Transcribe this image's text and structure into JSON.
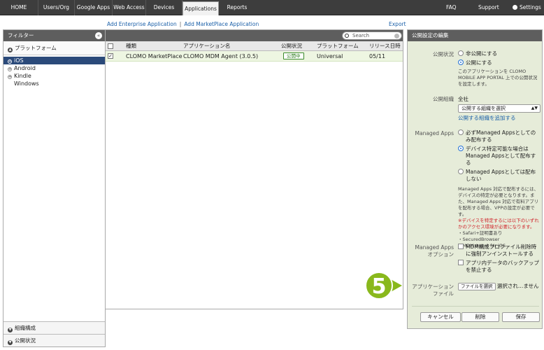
{
  "nav": {
    "tabs": [
      "HOME",
      "Users/Org",
      "Google Apps",
      "Web Access",
      "Devices",
      "Applications",
      "Reports"
    ],
    "active": "Applications",
    "right": {
      "faq": "FAQ",
      "support": "Support",
      "settings": "Settings"
    }
  },
  "sublinks": {
    "add_enterprise": "Add Enterprise Application",
    "sep": "|",
    "add_marketplace": "Add MarketPlace Application",
    "export": "Export"
  },
  "filter": {
    "title": "フィルター",
    "close": "«",
    "section_platform": "プラットフォーム",
    "platforms": [
      "iOS",
      "Android",
      "Kindle",
      "Windows"
    ],
    "selected": "iOS",
    "bottom_org": "組織構成",
    "bottom_status": "公開状況"
  },
  "table": {
    "search_placeholder": "Search",
    "headers": [
      "種類",
      "アプリケーション名",
      "公開状況",
      "プラットフォーム",
      "リリース日時"
    ],
    "rows": [
      {
        "type": "CLOMO MarketPlace",
        "name": "CLOMO MDM Agent (3.0.5)",
        "status": "公開中",
        "platform": "Universal",
        "release": "05/11",
        "checked": true
      }
    ]
  },
  "panel": {
    "title": "公開設定の編集",
    "publish_label": "公開状況",
    "publish_off": "非公開にする",
    "publish_on": "公開にする",
    "publish_note": "このアプリケーションを CLOMO MOBILE APP PORTAL 上での公開状況を設定します。",
    "org_label": "公開組織",
    "org_value": "全社",
    "org_select": "公開する組織を選択",
    "org_add": "公開する組織を追加する",
    "managed_label": "Managed Apps",
    "managed_opt1": "必ずManaged Appsとしてのみ配布する",
    "managed_opt2": "デバイス特定可能な場合はManaged Appsとして配布する",
    "managed_opt3": "Managed Appsとしては配布しない",
    "managed_note": "Managed Apps 対応で配布するには、デバイスの特定が必要となります。また、Managed Apps 対応で有料アプリを配布する場合、VPPの設定が必要です。",
    "managed_warn": "※デバイスを特定するには以下のいずれかのアクセス環境が必要になります。",
    "managed_list": [
      "・Safari+証明書あり",
      "・SecuredBrowser",
      "・MDM Agent for iOS"
    ],
    "option_label1": "Managed Apps",
    "option_label2": "オプション",
    "option1": "MDM構成プロファイル削除時に強制アンインストールする",
    "option2": "アプリ内データのバックアップを禁止する",
    "file_label1": "アプリケーション",
    "file_label2": "ファイル",
    "file_button": "ファイルを選択",
    "file_status": "選択され…ません",
    "cancel": "キャンセル",
    "delete": "削除",
    "save": "保存"
  },
  "step": "5",
  "colors": {
    "accent_green": "#89b81c",
    "nav_bg": "#3d3d3d",
    "link": "#1a5fa8"
  }
}
